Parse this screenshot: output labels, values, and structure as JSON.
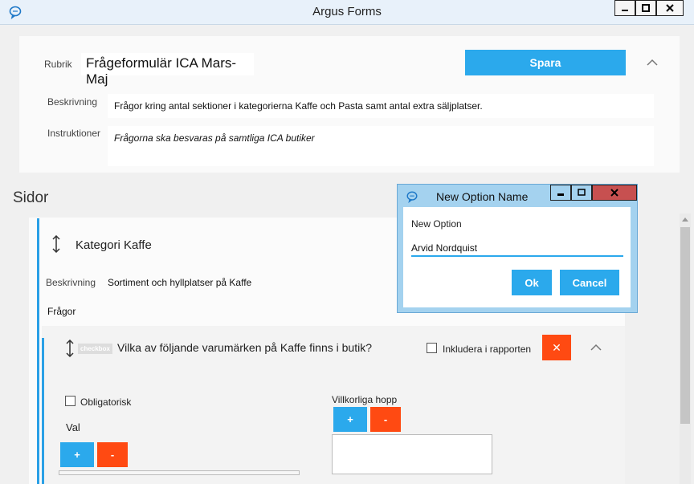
{
  "window": {
    "title": "Argus Forms"
  },
  "form": {
    "rubrik_label": "Rubrik",
    "rubrik_value": "Frågeformulär ICA Mars-Maj",
    "save_label": "Spara",
    "beskrivning_label": "Beskrivning",
    "beskrivning_value": "Frågor kring antal sektioner i kategorierna Kaffe och Pasta samt antal extra säljplatser.",
    "instruktioner_label": "Instruktioner",
    "instruktioner_value": "Frågorna ska besvaras på samtliga ICA butiker"
  },
  "pages": {
    "section_title": "Sidor",
    "page": {
      "title": "Kategori Kaffe",
      "beskrivning_label": "Beskrivning",
      "beskrivning_value": "Sortiment och hyllplatser på Kaffe",
      "fragor_label": "Frågor",
      "question": {
        "type_badge": "checkbox",
        "text": "Vilka av följande varumärken på Kaffe finns i butik?",
        "include_report_label": "Inkludera i rapporten",
        "delete_glyph": "✕",
        "obligatorisk_label": "Obligatorisk",
        "val_label": "Val",
        "add_glyph": "+",
        "remove_glyph": "-",
        "villkorliga_label": "Villkorliga hopp"
      }
    }
  },
  "dialog": {
    "title": "New Option Name",
    "prompt": "New Option",
    "input_value": "Arvid Nordquist",
    "ok_label": "Ok",
    "cancel_label": "Cancel"
  },
  "colors": {
    "accent": "#2ba9ec",
    "danger": "#ff4a12",
    "close": "#c75050"
  }
}
